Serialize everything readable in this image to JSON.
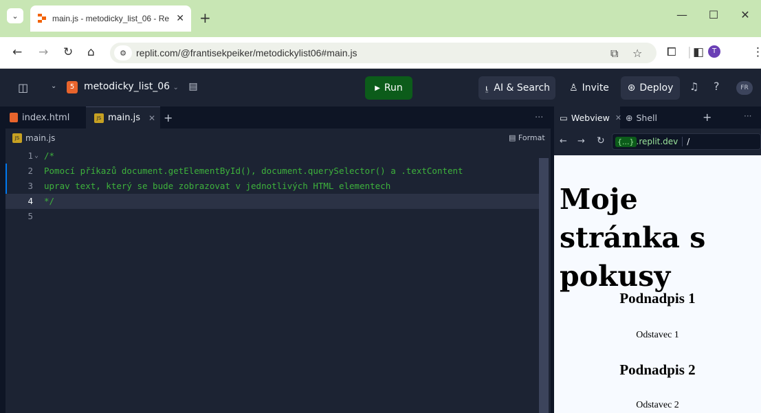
{
  "browser": {
    "tab_title": "main.js - metodicky_list_06 - Re",
    "new_tab": "+",
    "url": "replit.com/@frantisekpeiker/metodickylist06#main.js",
    "profile_initial": "T"
  },
  "replit": {
    "repl_name": "metodicky_list_06",
    "run_label": "Run",
    "ai_search_label": "AI & Search",
    "invite_label": "Invite",
    "deploy_label": "Deploy",
    "help": "?",
    "user_initials": "FR"
  },
  "editor": {
    "tabs": [
      {
        "label": "index.html",
        "active": false
      },
      {
        "label": "main.js",
        "active": true
      }
    ],
    "more": "···",
    "breadcrumb_file": "main.js",
    "format_label": "Format",
    "lines": [
      {
        "num": "1",
        "text": "/*"
      },
      {
        "num": "2",
        "text": "Pomocí příkazů document.getElementById(), document.querySelector() a .textContent"
      },
      {
        "num": "3",
        "text": "uprav text, který se bude zobrazovat v jednotlivých HTML elementech"
      },
      {
        "num": "4",
        "text": "*/"
      },
      {
        "num": "5",
        "text": ""
      }
    ]
  },
  "right_pane": {
    "tabs": [
      {
        "label": "Webview"
      },
      {
        "label": "Shell"
      }
    ],
    "add": "+",
    "more": "···",
    "domain_badge": "{...}",
    "domain_text": ".replit.dev",
    "path": "/"
  },
  "preview": {
    "h1": "Moje stránka s pokusy",
    "sections": [
      {
        "heading": "Podnadpis 1",
        "paragraph": "Odstavec 1"
      },
      {
        "heading": "Podnadpis 2",
        "paragraph": "Odstavec 2"
      }
    ]
  }
}
